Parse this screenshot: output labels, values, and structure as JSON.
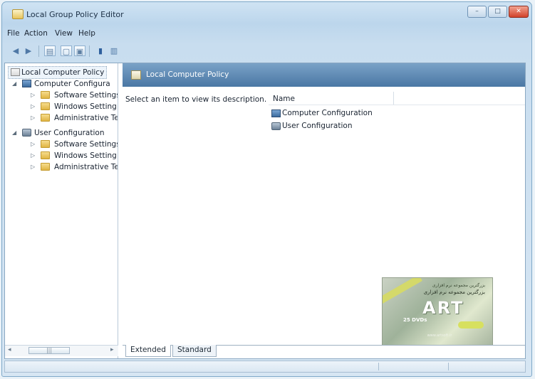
{
  "window": {
    "title": "Local Group Policy Editor",
    "buttons": {
      "minimize": "–",
      "maximize": "□",
      "close": "✕"
    }
  },
  "menu": {
    "items": [
      "File",
      "Action",
      "View",
      "Help"
    ]
  },
  "toolbar": {
    "icons": [
      "back-arrow-icon",
      "forward-arrow-icon",
      "show-hide-tree-icon",
      "properties-icon",
      "export-list-icon",
      "help-icon",
      "show-hide-action-pane-icon"
    ]
  },
  "tree": {
    "root": "Local Computer Policy",
    "items": [
      {
        "label": "Computer Configura",
        "level": 1,
        "icon": "computer-icon",
        "expanded": true
      },
      {
        "label": "Software Settings",
        "level": 2,
        "icon": "folder-icon"
      },
      {
        "label": "Windows Setting",
        "level": 2,
        "icon": "folder-icon"
      },
      {
        "label": "Administrative Te",
        "level": 2,
        "icon": "folder-icon"
      },
      {
        "label": "User Configuration",
        "level": 1,
        "icon": "user-icon",
        "expanded": true
      },
      {
        "label": "Software Settings",
        "level": 2,
        "icon": "folder-icon"
      },
      {
        "label": "Windows Setting",
        "level": 2,
        "icon": "folder-icon"
      },
      {
        "label": "Administrative Te",
        "level": 2,
        "icon": "folder-icon"
      }
    ],
    "scrollbar": {
      "left": "◂",
      "right": "▸",
      "thumb": "|||"
    }
  },
  "content": {
    "header": "Local Computer Policy",
    "description": "Select an item to view its description.",
    "list": {
      "column_name": "Name",
      "items": [
        "Computer Configuration",
        "User Configuration"
      ]
    }
  },
  "tabs": [
    "Extended",
    "Standard"
  ],
  "ad": {
    "small_text": "بزرگترین مجموعه نرم افزاری",
    "logo": "ART",
    "dvd": "25 DVDs",
    "footer": "www.artsoft.ir"
  }
}
